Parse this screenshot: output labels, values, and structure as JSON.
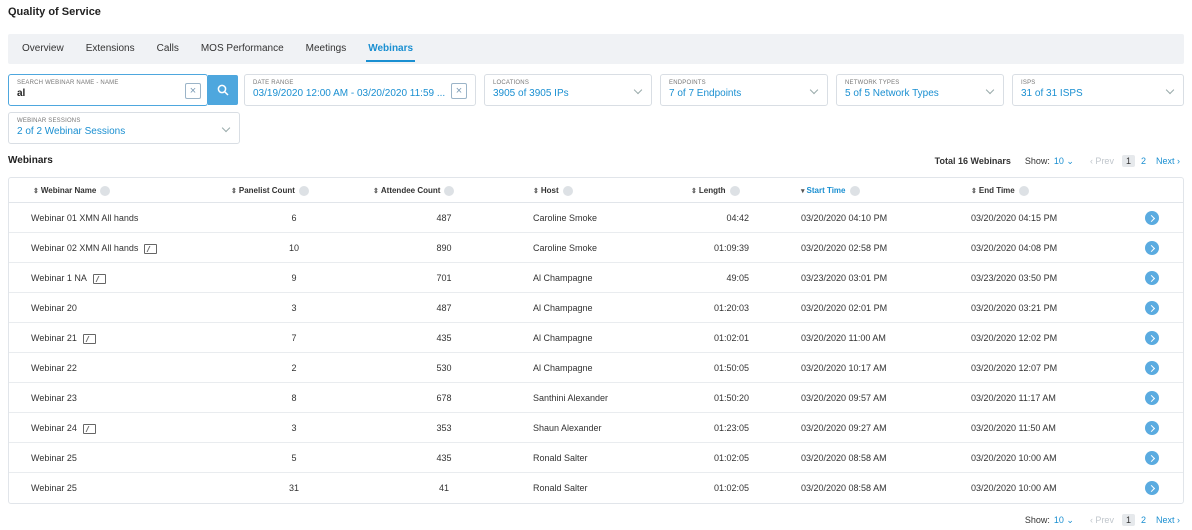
{
  "page_title": "Quality of Service",
  "tabs": [
    {
      "label": "Overview"
    },
    {
      "label": "Extensions"
    },
    {
      "label": "Calls"
    },
    {
      "label": "MOS Performance"
    },
    {
      "label": "Meetings"
    },
    {
      "label": "Webinars",
      "active": true
    }
  ],
  "filters": {
    "search": {
      "label": "SEARCH WEBINAR NAME - NAME",
      "value": "al"
    },
    "date_range": {
      "label": "DATE RANGE",
      "value": "03/19/2020 12:00 AM - 03/20/2020 11:59 ..."
    },
    "locations": {
      "label": "LOCATIONS",
      "value": "3905 of 3905 IPs"
    },
    "endpoints": {
      "label": "ENDPOINTS",
      "value": "7 of 7 Endpoints"
    },
    "network_types": {
      "label": "NETWORK TYPES",
      "value": "5 of 5 Network Types"
    },
    "isps": {
      "label": "ISPS",
      "value": "31 of 31 ISPS"
    },
    "webinar_sessions": {
      "label": "WEBINAR SESSIONS",
      "value": "2 of 2 Webinar Sessions"
    }
  },
  "section_title": "Webinars",
  "pager": {
    "total": "Total 16 Webinars",
    "show_label": "Show:",
    "show_value": "10",
    "prev": "‹ Prev",
    "pages": [
      "1",
      "2"
    ],
    "next": "Next ›"
  },
  "columns": [
    "Webinar Name",
    "Panelist Count",
    "Attendee Count",
    "Host",
    "Length",
    "Start Time",
    "End Time"
  ],
  "rows": [
    {
      "name": "Webinar 01 XMN All hands",
      "panelists": "6",
      "attendees": "487",
      "host": "Caroline Smoke",
      "length": "04:42",
      "start": "03/20/2020 04:10 PM",
      "end": "03/20/2020 04:15 PM",
      "share": false
    },
    {
      "name": "Webinar 02 XMN All hands",
      "panelists": "10",
      "attendees": "890",
      "host": "Caroline Smoke",
      "length": "01:09:39",
      "start": "03/20/2020 02:58 PM",
      "end": "03/20/2020 04:08 PM",
      "share": true
    },
    {
      "name": "Webinar 1 NA",
      "panelists": "9",
      "attendees": "701",
      "host": "Al Champagne",
      "length": "49:05",
      "start": "03/23/2020 03:01 PM",
      "end": "03/23/2020 03:50 PM",
      "share": true
    },
    {
      "name": "Webinar 20",
      "panelists": "3",
      "attendees": "487",
      "host": "Al Champagne",
      "length": "01:20:03",
      "start": "03/20/2020 02:01 PM",
      "end": "03/20/2020 03:21 PM",
      "share": false
    },
    {
      "name": "Webinar 21",
      "panelists": "7",
      "attendees": "435",
      "host": "Al Champagne",
      "length": "01:02:01",
      "start": "03/20/2020 11:00 AM",
      "end": "03/20/2020 12:02 PM",
      "share": true
    },
    {
      "name": "Webinar 22",
      "panelists": "2",
      "attendees": "530",
      "host": "Al Champagne",
      "length": "01:50:05",
      "start": "03/20/2020 10:17 AM",
      "end": "03/20/2020 12:07 PM",
      "share": false
    },
    {
      "name": "Webinar 23",
      "panelists": "8",
      "attendees": "678",
      "host": "Santhini Alexander",
      "length": "01:50:20",
      "start": "03/20/2020 09:57 AM",
      "end": "03/20/2020 11:17 AM",
      "share": false
    },
    {
      "name": "Webinar 24",
      "panelists": "3",
      "attendees": "353",
      "host": "Shaun Alexander",
      "length": "01:23:05",
      "start": "03/20/2020 09:27 AM",
      "end": "03/20/2020 11:50 AM",
      "share": true
    },
    {
      "name": "Webinar 25",
      "panelists": "5",
      "attendees": "435",
      "host": "Ronald Salter",
      "length": "01:02:05",
      "start": "03/20/2020 08:58 AM",
      "end": "03/20/2020 10:00 AM",
      "share": false
    },
    {
      "name": "Webinar 25",
      "panelists": "31",
      "attendees": "41",
      "host": "Ronald Salter",
      "length": "01:02:05",
      "start": "03/20/2020 08:58 AM",
      "end": "03/20/2020 10:00 AM",
      "share": false
    }
  ]
}
